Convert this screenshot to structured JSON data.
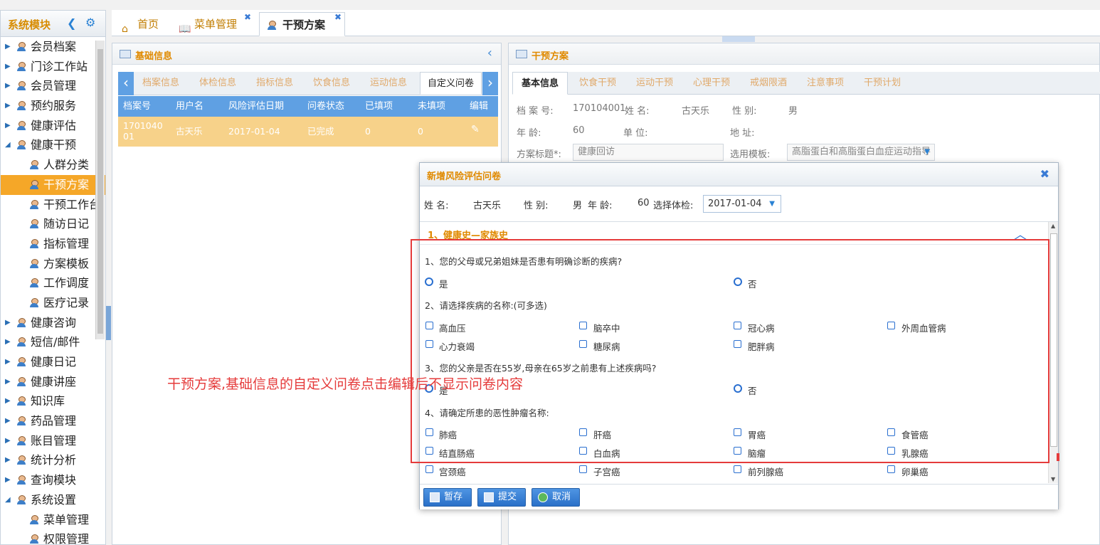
{
  "sidebar": {
    "title": "系统模块",
    "items": [
      {
        "label": "会员档案",
        "level": 1,
        "expanded": false
      },
      {
        "label": "门诊工作站",
        "level": 1,
        "expanded": false
      },
      {
        "label": "会员管理",
        "level": 1,
        "expanded": false
      },
      {
        "label": "预约服务",
        "level": 1,
        "expanded": false
      },
      {
        "label": "健康评估",
        "level": 1,
        "expanded": false
      },
      {
        "label": "健康干预",
        "level": 1,
        "expanded": true
      },
      {
        "label": "人群分类",
        "level": 2
      },
      {
        "label": "干预方案",
        "level": 2,
        "active": true
      },
      {
        "label": "干预工作台",
        "level": 2
      },
      {
        "label": "随访日记",
        "level": 2
      },
      {
        "label": "指标管理",
        "level": 2
      },
      {
        "label": "方案模板",
        "level": 2
      },
      {
        "label": "工作调度",
        "level": 2
      },
      {
        "label": "医疗记录",
        "level": 2
      },
      {
        "label": "健康咨询",
        "level": 1,
        "expanded": false
      },
      {
        "label": "短信/邮件",
        "level": 1,
        "expanded": false
      },
      {
        "label": "健康日记",
        "level": 1,
        "expanded": false
      },
      {
        "label": "健康讲座",
        "level": 1,
        "expanded": false
      },
      {
        "label": "知识库",
        "level": 1,
        "expanded": false
      },
      {
        "label": "药品管理",
        "level": 1,
        "expanded": false
      },
      {
        "label": "账目管理",
        "level": 1,
        "expanded": false
      },
      {
        "label": "统计分析",
        "level": 1,
        "expanded": false
      },
      {
        "label": "查询模块",
        "level": 1,
        "expanded": false
      },
      {
        "label": "系统设置",
        "level": 1,
        "expanded": true
      },
      {
        "label": "菜单管理",
        "level": 2
      },
      {
        "label": "权限管理",
        "level": 2
      }
    ]
  },
  "tabs": [
    {
      "label": "首页"
    },
    {
      "label": "菜单管理"
    },
    {
      "label": "干预方案",
      "active": true
    }
  ],
  "left_panel": {
    "title": "基础信息",
    "subtabs": [
      "档案信息",
      "体检信息",
      "指标信息",
      "饮食信息",
      "运动信息",
      "自定义问卷"
    ],
    "active_subtab": "自定义问卷",
    "grid": {
      "columns": [
        "档案号",
        "用户名",
        "风险评估日期",
        "问卷状态",
        "已填项",
        "未填项",
        "编辑"
      ],
      "rows": [
        {
          "id": "1701040\n01",
          "user": "古天乐",
          "date": "2017-01-04",
          "status": "已完成",
          "filled": "0",
          "unfilled": "0"
        }
      ]
    }
  },
  "right_panel": {
    "title": "干预方案",
    "tabs": [
      "基本信息",
      "饮食干预",
      "运动干预",
      "心理干预",
      "戒烟限酒",
      "注意事项",
      "干预计划"
    ],
    "fields": {
      "record_no_label": "档 案 号:",
      "record_no": "170104001",
      "name_label": "姓 名:",
      "name": "古天乐",
      "gender_label": "性 别:",
      "gender": "男",
      "age_label": "年 龄:",
      "age": "60",
      "unit_label": "单 位:",
      "address_label": "地 址:",
      "plan_title_label": "方案标题*:",
      "plan_title": "健康回访",
      "template_label": "选用模板:",
      "template": "高脂蛋白和高脂蛋白血症运动指导"
    }
  },
  "dialog": {
    "title": "新增风险评估问卷",
    "name_label": "姓 名:",
    "name": "古天乐",
    "gender_label": "性 别:",
    "gender": "男",
    "age_label": "年 龄:",
    "age": "60",
    "exam_label": "选择体检:",
    "exam_value": "2017-01-04",
    "section_title": "1、健康史—家族史",
    "q1": "1、您的父母或兄弟姐妹是否患有明确诊断的疾病?",
    "q1_yes": "是",
    "q1_no": "否",
    "q2": "2、请选择疾病的名称:(可多选)",
    "q2_options": [
      "高血压",
      "脑卒中",
      "冠心病",
      "外周血管病",
      "心力衰竭",
      "糖尿病",
      "肥胖病"
    ],
    "q3": "3、您的父亲是否在55岁,母亲在65岁之前患有上述疾病吗?",
    "q3_yes": "是",
    "q3_no": "否",
    "q4": "4、请确定所患的恶性肿瘤名称:",
    "q4_options": [
      "肺癌",
      "肝癌",
      "胃癌",
      "食管癌",
      "结直肠癌",
      "白血病",
      "脑瘤",
      "乳腺癌",
      "宫颈癌",
      "子宫癌",
      "前列腺癌",
      "卵巢癌"
    ],
    "buttons": {
      "save": "暂存",
      "submit": "提交",
      "cancel": "取消"
    }
  },
  "annotation": "干预方案,基础信息的自定义问卷点击编辑后不显示问卷内容",
  "colors": {
    "accent": "#e08a00",
    "primary": "#2a82d4",
    "active_nav": "#f5a728",
    "grid_row": "#f7d28a",
    "annotation": "#e53b3b"
  }
}
